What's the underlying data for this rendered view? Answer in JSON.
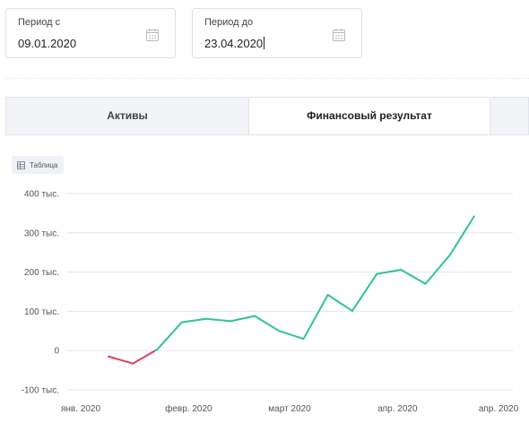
{
  "period_from": {
    "label": "Период с",
    "value": "09.01.2020"
  },
  "period_to": {
    "label": "Период до",
    "value": "23.04.2020"
  },
  "tabs": [
    {
      "label": "Активы",
      "active": false
    },
    {
      "label": "Финансовый результат",
      "active": true
    }
  ],
  "table_button": {
    "label": "Таблица",
    "icon": "table-icon"
  },
  "colors": {
    "positive": "#2ec58e",
    "negative": "#e23c63",
    "grid": "#e4e6ea"
  },
  "chart_data": {
    "type": "line",
    "x_tick_labels": [
      "янв. 2020",
      "февр. 2020",
      "март 2020",
      "апр. 2020",
      "апр. 2020"
    ],
    "y_tick_labels": [
      "400 тыс.",
      "300 тыс.",
      "200 тыс.",
      "100 тыс.",
      "0",
      "-100 тыс."
    ],
    "ylim": [
      -100000,
      400000
    ],
    "grid": true,
    "x": [
      "2020-01-09",
      "2020-01-16",
      "2020-01-23",
      "2020-01-30",
      "2020-02-06",
      "2020-02-13",
      "2020-02-20",
      "2020-02-27",
      "2020-03-05",
      "2020-03-12",
      "2020-03-19",
      "2020-03-26",
      "2020-04-02",
      "2020-04-09",
      "2020-04-16",
      "2020-04-23"
    ],
    "values": [
      -15000,
      -33000,
      3000,
      72000,
      81000,
      75000,
      88000,
      50000,
      30000,
      142000,
      101000,
      195000,
      206000,
      170000,
      243000,
      342000
    ]
  }
}
